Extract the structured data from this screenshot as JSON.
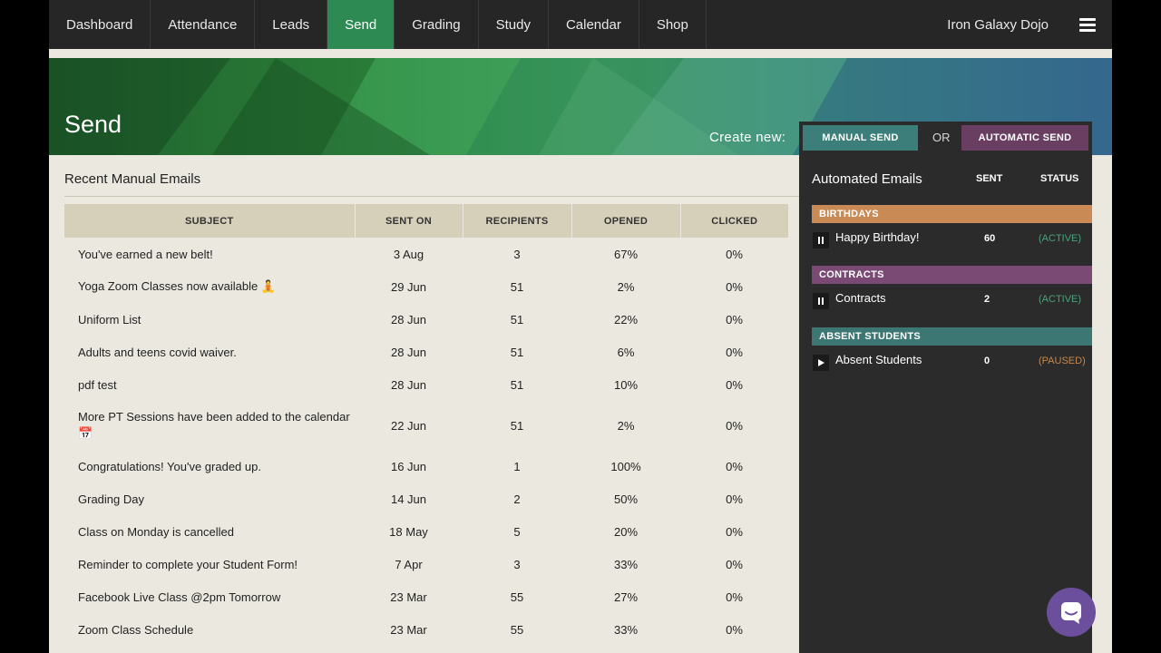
{
  "nav": {
    "items": [
      "Dashboard",
      "Attendance",
      "Leads",
      "Send",
      "Grading",
      "Study",
      "Calendar",
      "Shop"
    ],
    "active": "Send",
    "org_name": "Iron Galaxy Dojo"
  },
  "page": {
    "title": "Send"
  },
  "create": {
    "label": "Create new:",
    "manual": "MANUAL SEND",
    "or": "OR",
    "automatic": "AUTOMATIC SEND"
  },
  "recent": {
    "title": "Recent Manual Emails",
    "columns": [
      "SUBJECT",
      "SENT ON",
      "RECIPIENTS",
      "OPENED",
      "CLICKED"
    ],
    "rows": [
      {
        "subject": "You've earned a new belt!",
        "sent": "3 Aug",
        "recipients": "3",
        "opened": "67%",
        "clicked": "0%"
      },
      {
        "subject": "Yoga Zoom Classes now available 🧘",
        "sent": "29 Jun",
        "recipients": "51",
        "opened": "2%",
        "clicked": "0%"
      },
      {
        "subject": "Uniform List",
        "sent": "28 Jun",
        "recipients": "51",
        "opened": "22%",
        "clicked": "0%"
      },
      {
        "subject": "Adults and teens covid waiver.",
        "sent": "28 Jun",
        "recipients": "51",
        "opened": "6%",
        "clicked": "0%"
      },
      {
        "subject": "pdf test",
        "sent": "28 Jun",
        "recipients": "51",
        "opened": "10%",
        "clicked": "0%"
      },
      {
        "subject": "More PT Sessions have been added to the calendar 📅",
        "sent": "22 Jun",
        "recipients": "51",
        "opened": "2%",
        "clicked": "0%"
      },
      {
        "subject": "Congratulations! You've graded up.",
        "sent": "16 Jun",
        "recipients": "1",
        "opened": "100%",
        "clicked": "0%"
      },
      {
        "subject": "Grading Day",
        "sent": "14 Jun",
        "recipients": "2",
        "opened": "50%",
        "clicked": "0%"
      },
      {
        "subject": "Class on Monday is cancelled",
        "sent": "18 May",
        "recipients": "5",
        "opened": "20%",
        "clicked": "0%"
      },
      {
        "subject": "Reminder to complete your Student Form!",
        "sent": "7 Apr",
        "recipients": "3",
        "opened": "33%",
        "clicked": "0%"
      },
      {
        "subject": "Facebook Live Class @2pm Tomorrow",
        "sent": "23 Mar",
        "recipients": "55",
        "opened": "27%",
        "clicked": "0%"
      },
      {
        "subject": "Zoom Class Schedule",
        "sent": "23 Mar",
        "recipients": "55",
        "opened": "33%",
        "clicked": "0%"
      }
    ]
  },
  "automated": {
    "title": "Automated Emails",
    "col_sent": "SENT",
    "col_status": "STATUS",
    "groups": [
      {
        "category": "BIRTHDAYS",
        "name": "Happy Birthday!",
        "sent": "60",
        "status": "(ACTIVE)",
        "control": "pause"
      },
      {
        "category": "CONTRACTS",
        "name": "Contracts",
        "sent": "2",
        "status": "(ACTIVE)",
        "control": "pause"
      },
      {
        "category": "ABSENT STUDENTS",
        "name": "Absent Students",
        "sent": "0",
        "status": "(PAUSED)",
        "control": "play"
      }
    ]
  },
  "colors": {
    "active_nav": "#2e8a53",
    "manual_btn": "#3c7f7a",
    "auto_btn": "#6a3e61",
    "birthdays": "#c98a55",
    "contracts": "#7a4a75",
    "absent": "#3d7773",
    "chat": "#6b4f9c"
  },
  "icons": {
    "menu": "hamburger-icon",
    "pause": "pause-icon",
    "play": "play-icon",
    "chat": "chat-icon"
  }
}
